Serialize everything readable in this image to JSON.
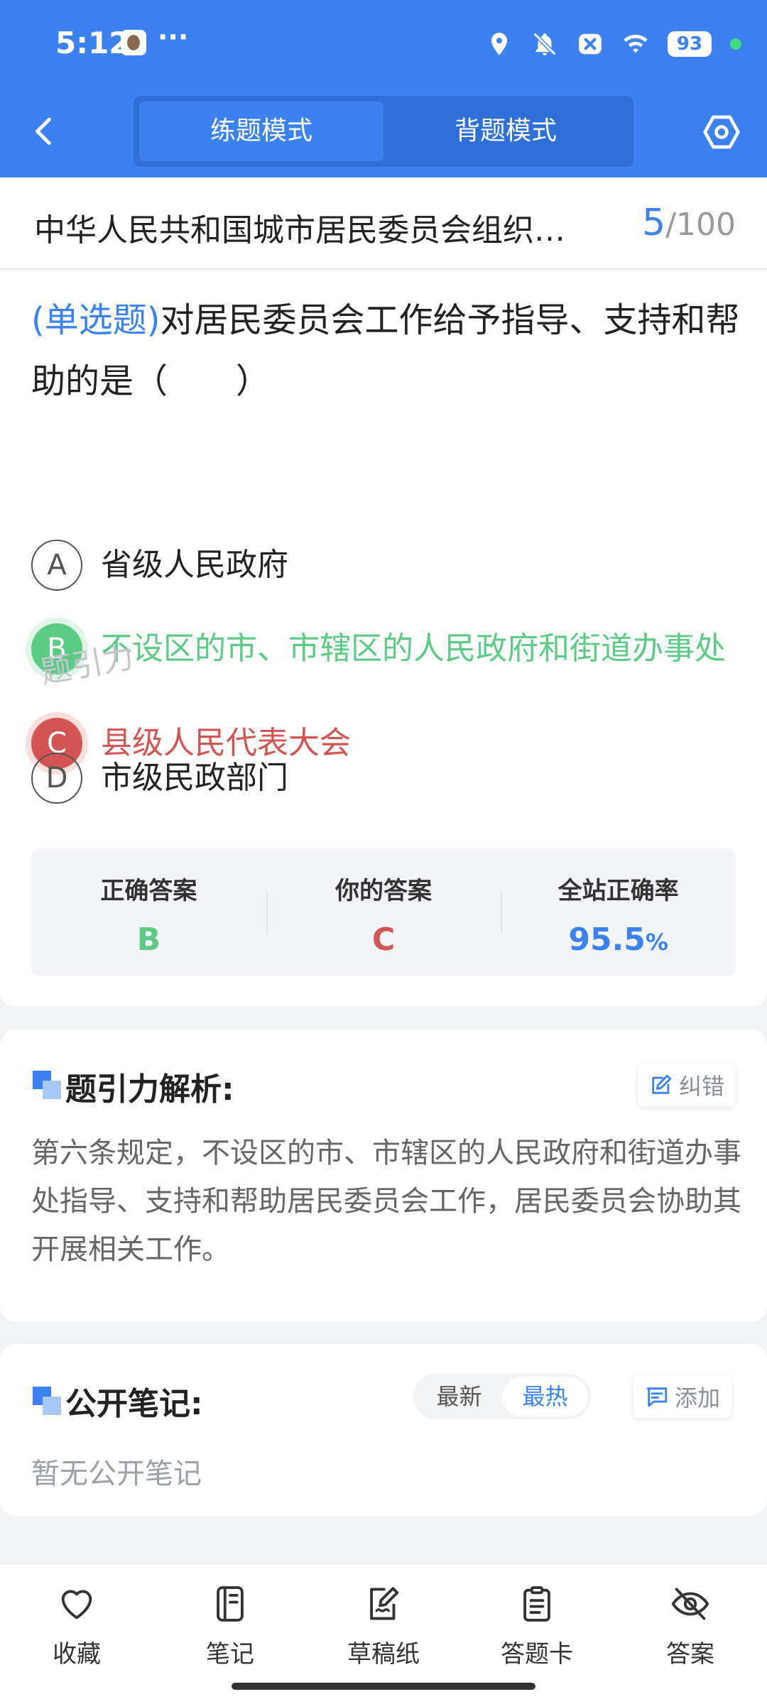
{
  "status_bar": {
    "time": "5:12",
    "more": "···",
    "battery": "93",
    "icons": [
      "location-icon",
      "bell-off-icon",
      "x-box-icon",
      "wifi-icon",
      "battery-icon"
    ]
  },
  "header": {
    "tabs": [
      {
        "label": "练题模式",
        "active": true
      },
      {
        "label": "背题模式",
        "active": false
      }
    ]
  },
  "title_bar": {
    "title": "中华人民共和国城市居民委员会组织…",
    "current": "5",
    "separator": "/",
    "total": "100"
  },
  "question": {
    "type": "(单选题)",
    "text": "对居民委员会工作给予指导、支持和帮助的是（　　）",
    "options": [
      {
        "letter": "A",
        "text": "省级人民政府",
        "state": "normal"
      },
      {
        "letter": "B",
        "text": "不设区的市、市辖区的人民政府和街道办事处",
        "state": "correct"
      },
      {
        "letter": "C",
        "text": "县级人民代表大会",
        "state": "wrong"
      },
      {
        "letter": "D",
        "text": "市级民政部门",
        "state": "normal"
      }
    ]
  },
  "answer_summary": {
    "correct_label": "正确答案",
    "correct_value": "B",
    "yours_label": "你的答案",
    "yours_value": "C",
    "rate_label": "全站正确率",
    "rate_value": "95.5",
    "rate_unit": "%",
    "watermark": "题引力"
  },
  "analysis": {
    "title": "题引力解析:",
    "report_label": "纠错",
    "text": "第六条规定，不设区的市、市辖区的人民政府和街道办事处指导、支持和帮助居民委员会工作，居民委员会协助其开展相关工作。"
  },
  "notes": {
    "title": "公开笔记:",
    "sort_newest": "最新",
    "sort_hottest": "最热",
    "add_label": "添加",
    "empty_text": "暂无公开笔记"
  },
  "bottom_nav": {
    "favorite": "收藏",
    "notes": "笔记",
    "scratch": "草稿纸",
    "answer_card": "答题卡",
    "answer": "答案"
  },
  "colors": {
    "primary": "#3b82f0",
    "correct": "#5ccb85",
    "wrong": "#d35553"
  }
}
